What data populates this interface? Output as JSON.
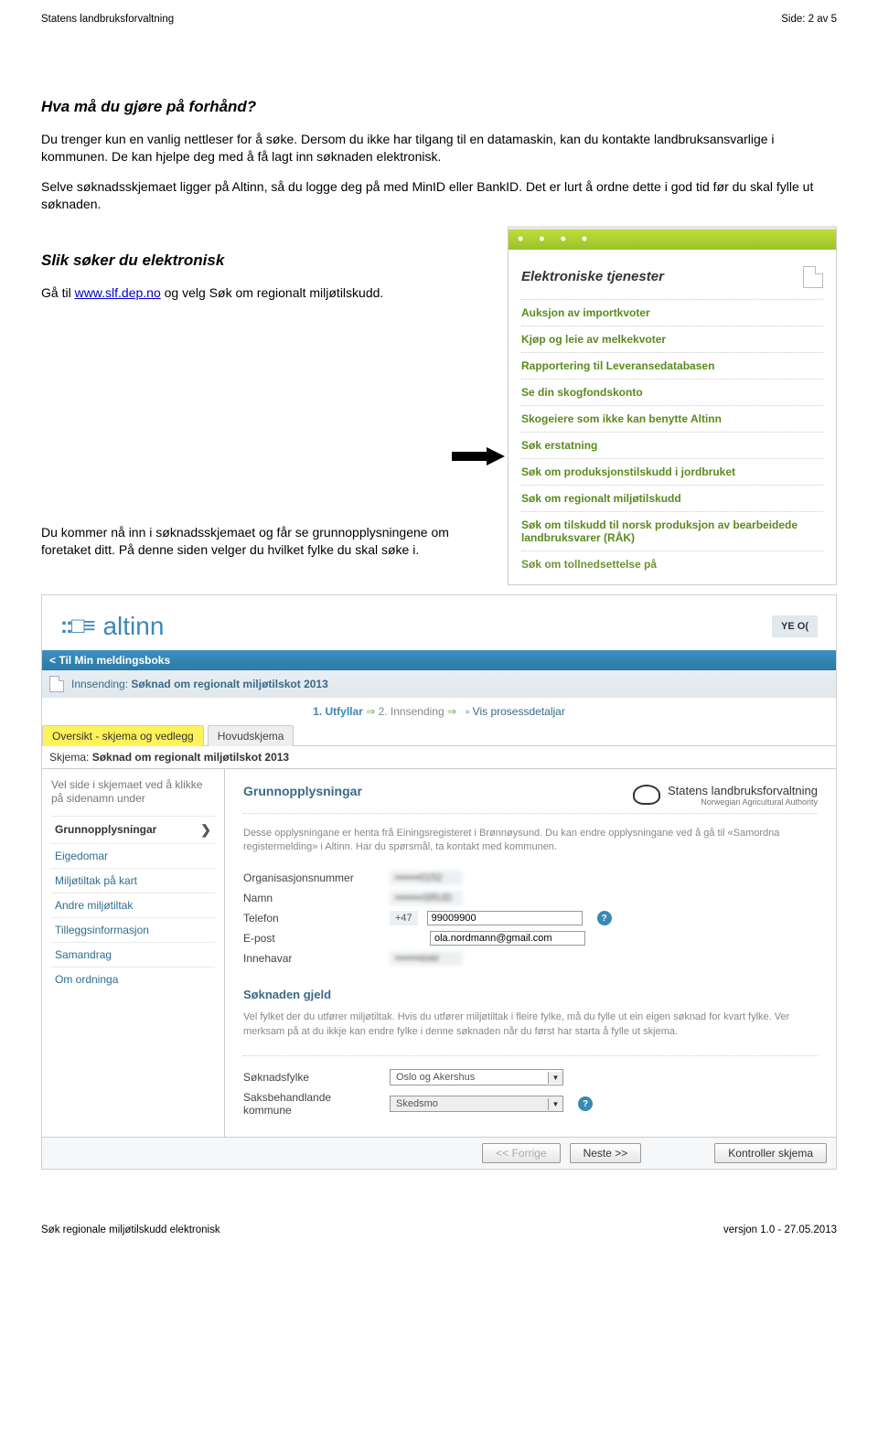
{
  "header": {
    "left": "Statens landbruksforvaltning",
    "right": "Side: 2 av 5"
  },
  "footer": {
    "left": "Søk regionale miljøtilskudd elektronisk",
    "right": "versjon 1.0 - 27.05.2013"
  },
  "section1": {
    "title": "Hva må du gjøre på forhånd?",
    "p1": "Du trenger kun en vanlig nettleser for å søke. Dersom du ikke har tilgang til en datamaskin, kan du kontakte landbruksansvarlige i kommunen. De kan hjelpe deg med å få lagt inn søknaden elektronisk.",
    "p2": "Selve søknadsskjemaet ligger på Altinn, så du logge deg på med MinID eller BankID. Det er lurt å ordne dette i god tid før du skal fylle ut søknaden."
  },
  "section2": {
    "title": "Slik søker du elektronisk",
    "p1a": "Gå til ",
    "link": "www.slf.dep.no",
    "p1b": " og velg Søk om regionalt miljøtilskudd.",
    "p2": "Du kommer nå inn i søknadsskjemaet og får se grunnopplysningene om foretaket ditt. På denne siden velger du hvilket fylke du skal søke i."
  },
  "widget": {
    "dots": "• • • •",
    "title": "Elektroniske tjenester",
    "items": [
      "Auksjon av importkvoter",
      "Kjøp og leie av melkekvoter",
      "Rapportering til Leveransedatabasen",
      "Se din skogfondskonto",
      "Skogeiere som ikke kan benytte Altinn",
      "Søk erstatning",
      "Søk om produksjonstilskudd i jordbruket",
      "Søk om regionalt miljøtilskudd",
      "Søk om tilskudd til norsk produksjon av bearbeidede landbruksvarer (RÅK)",
      "Søk om tollnedsettelse på"
    ]
  },
  "altinn": {
    "logo_glyph": "::□≡",
    "logo_name": "altinn",
    "top_right": "YE O(",
    "back": "<  Til Min meldingsboks",
    "form_title_prefix": "Innsending: ",
    "form_title": "Søknad om regionalt miljøtilskot 2013",
    "step1": "1. Utfyllar",
    "step_arrow": "⇒",
    "step2": "2. Innsending",
    "step_link": "Vis prosessdetaljar",
    "tab1": "Oversikt - skjema og vedlegg",
    "tab2": "Hovudskjema",
    "schema_lbl": "Skjema:",
    "schema_name": "Søknad om regionalt miljøtilskot 2013",
    "side_hint": "Vel side i skjemaet ved å klikke på sidenamn under",
    "side_items": [
      "Grunnopplysningar",
      "Eigedomar",
      "Miljøtiltak på kart",
      "Andre miljøtiltak",
      "Tilleggsinformasjon",
      "Samandrag",
      "Om ordninga"
    ],
    "main": {
      "heading": "Grunnopplysningar",
      "brand_big": "Statens landbruksforvaltning",
      "brand_small": "Norwegian Agricultural Authority",
      "note": "Desse opplysningane er henta frå Einingsregisteret i Brønnøysund. Du kan endre opplysningane ved å gå til «Samordna registermelding» i Altinn. Har du spørsmål, ta kontakt med kommunen.",
      "f_org_lbl": "Organisasjonsnummer",
      "f_org_val": "•••••••0152",
      "f_namn_lbl": "Namn",
      "f_namn_val": "••••••••SRUD",
      "f_tel_lbl": "Telefon",
      "f_tel_prefix": "+47",
      "f_tel_val": "99009900",
      "f_epost_lbl": "E-post",
      "f_epost_val": "ola.nordmann@gmail.com",
      "f_inne_lbl": "Innehavar",
      "f_inne_val": "•••••••ever",
      "sub": "Søknaden gjeld",
      "sub_note": "Vel fylket der du utfører miljøtiltak. Hvis du utfører miljøtiltak i fleire fylke, må du fylle ut ein eigen søknad for kvart fylke. Ver merksam på at du ikkje kan endre fylke i denne søknaden når du først har starta å fylle ut skjema.",
      "f_fylke_lbl": "Søknadsfylke",
      "f_fylke_val": "Oslo og Akershus",
      "f_komm_lbl": "Saksbehandlande kommune",
      "f_komm_val": "Skedsmo"
    },
    "btn_prev": "<< Forrige",
    "btn_next": "Neste >>",
    "btn_check": "Kontroller skjema"
  }
}
